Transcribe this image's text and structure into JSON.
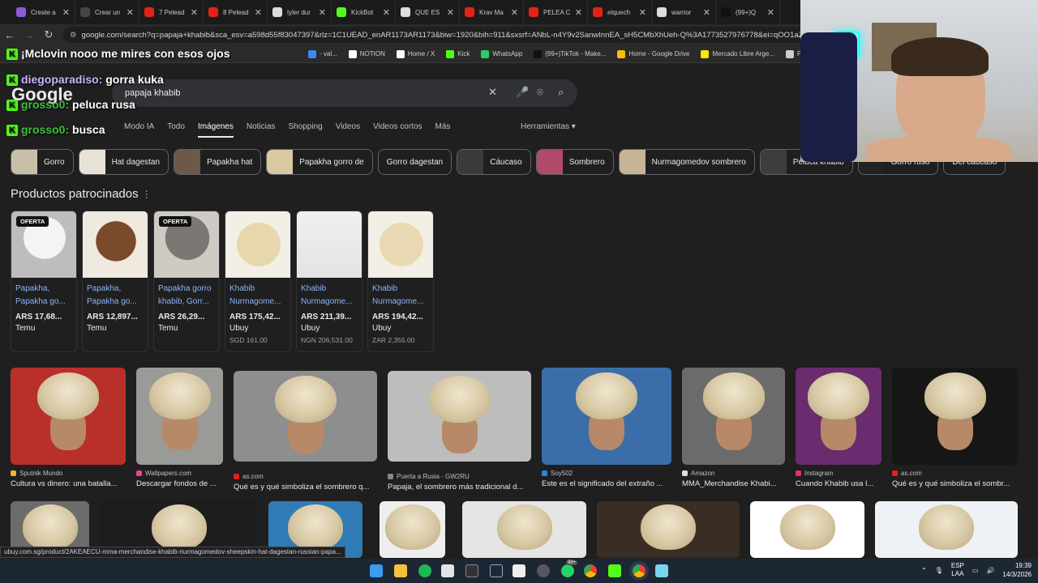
{
  "tabs": [
    {
      "title": "Create a",
      "color": "#8e5bd6"
    },
    {
      "title": "Crear un",
      "color": "#444"
    },
    {
      "title": "7 Pelead",
      "color": "#e62117"
    },
    {
      "title": "8 Pelead",
      "color": "#e62117"
    },
    {
      "title": "tyler dur",
      "color": "#ddd"
    },
    {
      "title": "KickBot",
      "color": "#53fc18"
    },
    {
      "title": "QUE ES",
      "color": "#ddd"
    },
    {
      "title": "Krav Ma",
      "color": "#e62117"
    },
    {
      "title": "PELEA C",
      "color": "#e62117"
    },
    {
      "title": "elquech",
      "color": "#e62117"
    },
    {
      "title": "warrior",
      "color": "#ddd"
    },
    {
      "title": "(99+)Q",
      "color": "#111"
    }
  ],
  "address": {
    "url": "google.com/search?q=papaja+khabib&sca_esv=a598d55f83047397&rlz=1C1UEAD_enAR1173AR1173&biw=1920&bih=911&sxsrf=ANbL-n4Y9v2SanwInnEA_sH5CMbXhUeh-Q%3A1773527976778&ei=qOO1aZOdL6"
  },
  "bookmarks": [
    {
      "label": "- val...",
      "color": "#4285f4"
    },
    {
      "label": "NOTION",
      "color": "#fff"
    },
    {
      "label": "Home / X",
      "color": "#fff"
    },
    {
      "label": "Kick",
      "color": "#53fc18"
    },
    {
      "label": "WhatsApp",
      "color": "#25d366"
    },
    {
      "label": "(99+)TikTok - Make...",
      "color": "#111"
    },
    {
      "label": "Home - Google Drive",
      "color": "#fbbc04"
    },
    {
      "label": "Mercado Libre Arge...",
      "color": "#ffe600"
    },
    {
      "label": "PROG",
      "color": "#ccc"
    }
  ],
  "chat": [
    {
      "user": "",
      "message": "¡Mclovin nooo me mires con esos ojos"
    },
    {
      "user": "diegoparadiso:",
      "message": "gorra kuka"
    },
    {
      "user": "grosso0:",
      "message": "peluca rusa"
    },
    {
      "user": "grosso0:",
      "message": "busca"
    }
  ],
  "search": {
    "logo": "Google",
    "query": "papaja khabib",
    "modes": [
      "Modo IA",
      "Todo",
      "Imágenes",
      "Noticias",
      "Shopping",
      "Videos",
      "Videos cortos",
      "Más"
    ],
    "active_mode": "Imágenes",
    "tools": "Herramientas"
  },
  "chips": [
    "Gorro",
    "Hat dagestan",
    "Papakha hat",
    "Papakha gorro de",
    "Gorro dagestan",
    "Cáucaso",
    "Sombrero",
    "Nurmagomedov sombrero",
    "Peluca khabib",
    "Gorro ruso",
    "Del cáucaso"
  ],
  "sponsored_title": "Productos patrocinados",
  "products": [
    {
      "badge": "OFERTA",
      "title": "Papakha, Papakha go...",
      "price": "ARS 17,68...",
      "store": "Temu",
      "orig": ""
    },
    {
      "badge": "",
      "title": "Papakha, Papakha go...",
      "price": "ARS 12,897...",
      "store": "Temu",
      "orig": ""
    },
    {
      "badge": "OFERTA",
      "title": "Papakha gorro khabib, Gorr...",
      "price": "ARS 26,29...",
      "store": "Temu",
      "orig": ""
    },
    {
      "badge": "",
      "title": "Khabib Nurmagome...",
      "price": "ARS 175,42...",
      "store": "Ubuy",
      "orig": "SGD 161.00"
    },
    {
      "badge": "",
      "title": "Khabib Nurmagome...",
      "price": "ARS 211,39...",
      "store": "Ubuy",
      "orig": "NGN 206,531.00"
    },
    {
      "badge": "",
      "title": "Khabib Nurmagome...",
      "price": "ARS 194,42...",
      "store": "Ubuy",
      "orig": "ZAR 2,355.00"
    }
  ],
  "images_row1": [
    {
      "source": "Sputnik Mundo",
      "caption": "Cultura vs dinero: una batalla...",
      "color": "#f3b32a"
    },
    {
      "source": "Wallpapers.com",
      "caption": "Descargar fondos de ...",
      "color": "#e84393"
    },
    {
      "source": "as.com",
      "caption": "Qué es y qué simboliza el sombrero q...",
      "color": "#e62117"
    },
    {
      "source": "Puerta a Rusia - GW2RU",
      "caption": "Papaja, el sombrero más tradicional d...",
      "color": "#888"
    },
    {
      "source": "Soy502",
      "caption": "Este es el significado del extraño ...",
      "color": "#1e88e5"
    },
    {
      "source": "Amazon",
      "caption": "MMA_Merchandise Khabi...",
      "color": "#ddd"
    },
    {
      "source": "Instagram",
      "caption": "Cuando Khabib usa l...",
      "color": "#e1306c"
    },
    {
      "source": "as.com",
      "caption": "Qué es y qué simboliza el sombr...",
      "color": "#e62117"
    }
  ],
  "status_url": "ubuy.com.sg/product/2AKEAECU-mma-merchandise-khabib-nurmagomedov-sheepskin-hat-dagestan-russian-papa...",
  "tray": {
    "lang": "ESP",
    "region": "LAA",
    "time": "19:39",
    "date": "14/3/2026",
    "badge": "99+"
  }
}
